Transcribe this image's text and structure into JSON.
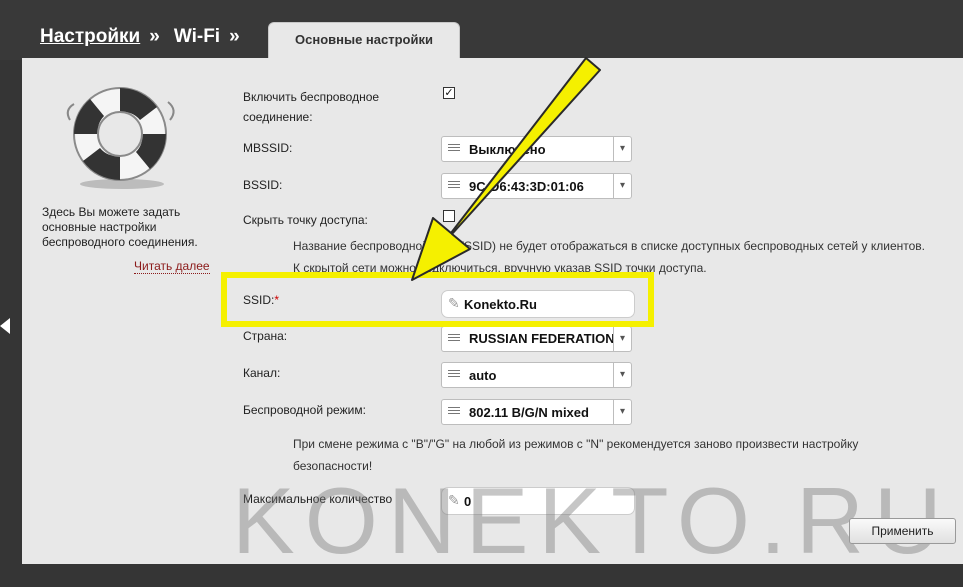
{
  "breadcrumb": {
    "settings": "Настройки",
    "sep1": "»",
    "wifi": "Wi-Fi",
    "sep2": "»"
  },
  "tab": {
    "label": "Основные настройки"
  },
  "sidebar": {
    "help_text": "Здесь Вы можете задать основные настройки беспроводного соединения.",
    "read_more": "Читать далее"
  },
  "form": {
    "enable_wireless": {
      "label": "Включить беспроводное соединение:",
      "checked": true
    },
    "mbssid": {
      "label": "MBSSID:",
      "value": "Выключено"
    },
    "bssid": {
      "label": "BSSID:",
      "value": "9C:D6:43:3D:01:06"
    },
    "hide_ap": {
      "label": "Скрыть точку доступа:",
      "checked": false
    },
    "hide_ap_note_1": "Название беспроводной сети (SSID) не будет отображаться в списке доступных беспроводных сетей у клиентов.",
    "hide_ap_note_2": "К скрытой сети можно подключиться, вручную указав SSID точки доступа.",
    "ssid": {
      "label": "SSID:",
      "required_mark": "*",
      "value": "Konekto.Ru"
    },
    "country": {
      "label": "Страна:",
      "value": "RUSSIAN FEDERATION"
    },
    "channel": {
      "label": "Канал:",
      "value": "auto"
    },
    "mode": {
      "label": "Беспроводной режим:",
      "value": "802.11 B/G/N mixed"
    },
    "mode_note_1": "При смене режима с \"B\"/\"G\" на любой из режимов с \"N\" рекомендуется заново произвести настройку",
    "mode_note_2": "безопасности!",
    "max_clients": {
      "label": "Максимальное количество",
      "value": "0"
    },
    "apply_button": "Применить"
  },
  "watermark": "KONEKTO.RU",
  "colors": {
    "highlight": "#f5f000",
    "background": "#353535",
    "panel": "#e8e8e8",
    "required": "#cc0000"
  }
}
